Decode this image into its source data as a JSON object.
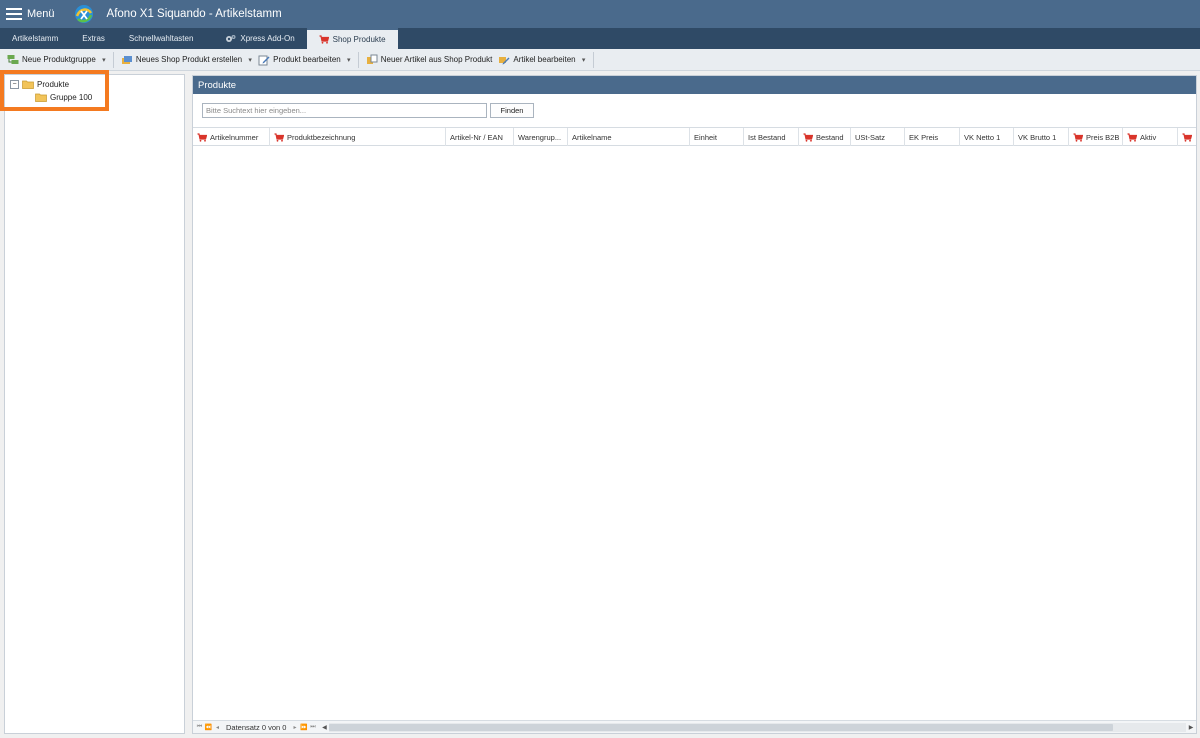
{
  "titlebar": {
    "menu_label": "Menü",
    "app_title": "Afono X1 Siquando - Artikelstamm"
  },
  "tabs": [
    {
      "label": "Artikelstamm"
    },
    {
      "label": "Extras"
    },
    {
      "label": "Schnellwahltasten"
    },
    {
      "label": "Xpress Add-On",
      "icon": "gears-icon"
    },
    {
      "label": "Shop Produkte",
      "icon": "shopping-cart-icon",
      "active": true
    }
  ],
  "toolbar": {
    "new_group": "Neue Produktgruppe",
    "new_shop_product": "Neues Shop Produkt erstellen",
    "edit_product": "Produkt bearbeiten",
    "new_article_from_shop": "Neuer Artikel aus Shop Produkt",
    "edit_article": "Artikel bearbeiten"
  },
  "tree": {
    "root": "Produkte",
    "children": [
      "Gruppe 100"
    ],
    "toggle": "−"
  },
  "main": {
    "title": "Produkte",
    "search_placeholder": "Bitte Suchtext hier eingeben...",
    "search_value": "",
    "find_label": "Finden"
  },
  "columns": [
    {
      "label": "Artikelnummer",
      "shop": true
    },
    {
      "label": "Produktbezeichnung",
      "shop": true
    },
    {
      "label": "Artikel-Nr / EAN",
      "shop": false
    },
    {
      "label": "Warengrup...",
      "shop": false
    },
    {
      "label": "Artikelname",
      "shop": false
    },
    {
      "label": "Einheit",
      "shop": false
    },
    {
      "label": "Ist Bestand",
      "shop": false
    },
    {
      "label": "Bestand",
      "shop": true
    },
    {
      "label": "USt-Satz",
      "shop": false
    },
    {
      "label": "EK Preis",
      "shop": false
    },
    {
      "label": "VK Netto 1",
      "shop": false
    },
    {
      "label": "VK Brutto 1",
      "shop": false
    },
    {
      "label": "Preis B2B",
      "shop": true
    },
    {
      "label": "Aktiv",
      "shop": true
    },
    {
      "label": "",
      "shop": true
    }
  ],
  "navigator": {
    "record_text": "Datensatz 0 von 0",
    "horizontal_scroll_position": 0,
    "horizontal_scroll_visible_fraction": 0.915
  },
  "colors": {
    "title_bar": "#4a6a8c",
    "tab_bar": "#2f4a66",
    "highlight": "#f47a20",
    "cart": "#d9342b",
    "folder": "#f2c45a"
  }
}
